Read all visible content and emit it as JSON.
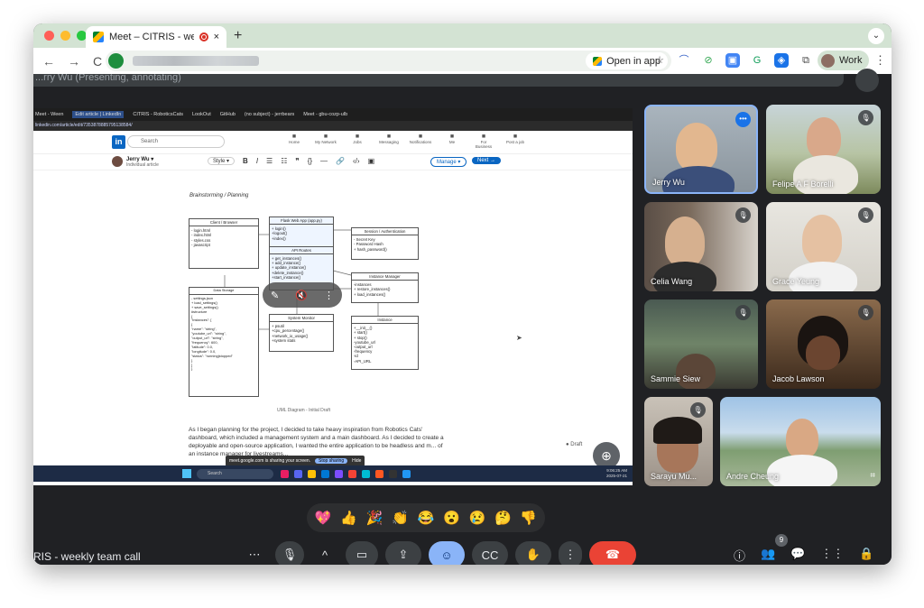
{
  "browser": {
    "tab_title": "Meet – CITRIS - weekly te",
    "tab_close": "×",
    "new_tab": "+",
    "tab_menu": "⌄",
    "open_in_app": "Open in app",
    "profile_name": "Work",
    "nav_back": "←",
    "nav_forward": "→",
    "nav_reload": "C"
  },
  "topbar_text": "...rry Wu (Presenting, annotating)",
  "shared_screen": {
    "browser_tabs": [
      "Meet - Ween",
      "Edit article | LinkedIn",
      "CITRIS - RoboticsCats",
      "LookOut",
      "GitHub",
      "(no subject) - jerrbears",
      "Meet - gbu-cozp-ulb"
    ],
    "address": "linkedin.com/article/edit/7353878885795138584/",
    "search_placeholder": "Search",
    "ln_nav": [
      "Home",
      "My Network",
      "Jobs",
      "Messaging",
      "Notifications",
      "Me",
      "For Business",
      "Post a job"
    ],
    "author_name": "Jerry Wu ▾",
    "author_sub": "Individual article",
    "style_label": "Style ▾",
    "manage_label": "Manage ▾",
    "next_label": "Next →",
    "heading": "Brainstorming / Planning",
    "uml": {
      "client": {
        "title": "Client / Browser",
        "lines": [
          "- login.html",
          "- index.html",
          "- styles.css",
          "- javascript"
        ]
      },
      "flask": {
        "title": "Flask Web App (app.py)",
        "lines": [
          "+ login()",
          "+logout()",
          "+index()"
        ]
      },
      "api": {
        "title": "API Routes",
        "lines": [
          "+ get_instances()",
          "+ add_instance()",
          "+ update_instance()",
          "+delete_instance()",
          "+start_instance()"
        ]
      },
      "session": {
        "title": "Session / Authentication",
        "lines": [
          "- Secret Key",
          "- Password Hash",
          "+ hash_password()"
        ]
      },
      "manager": {
        "title": "Instance Manager",
        "lines": [
          "-instances",
          "+ restore_instances()",
          "+ load_instances()"
        ]
      },
      "storage": {
        "title": "Data Storage",
        "lines": [
          "- settings.json",
          "+ load_settings()",
          "+ save_settings()",
          "",
          "#structure",
          "",
          "{",
          "  \"instances\": [",
          "   {",
          "    \"name\": \"string\",",
          "    \"youtube_url\": \"string\",",
          "    \"output_url\": \"string\",",
          "    \"frequency\": 600,",
          "    \"latitude\": 0.0,",
          "    \"longitude\": 0.0,",
          "    \"status\": \"running|stopped\"",
          "   }",
          "  ]",
          "}"
        ]
      },
      "monitor": {
        "title": "System Monitor",
        "lines": [
          "+ psutil",
          "+cpu_percentage()",
          "+network_io_usage()",
          "+system stats"
        ]
      },
      "instance": {
        "title": "Instance",
        "lines": [
          "+__init__()",
          "+ start()",
          "+ stop()",
          "-youtube_url",
          "-output_url",
          "-frequency",
          "-id",
          "-API_URL"
        ]
      }
    },
    "caption": "UML Diagram - Initial Draft",
    "paragraph": "As I began planning for the project, I decided to take heavy inspiration from Robotics Cats' dashboard, which included a management system and a main dashboard. As I decided to create a deployable and open-source application, I wanted the entire application to be headless and m... of an instance manager for livestreams...",
    "share_notice": "meet.google.com is sharing your screen.",
    "stop_sharing": "Stop sharing",
    "hide": "Hide",
    "draft_label": "Draft",
    "taskbar_search": "Search",
    "tray_time": "9:06:25 AM",
    "tray_date": "2025-07-21",
    "tray_lang": "ENG US"
  },
  "participants": [
    {
      "name": "Jerry Wu",
      "muted": false
    },
    {
      "name": "Felipe A F Borelli",
      "muted": true
    },
    {
      "name": "Celia Wang",
      "muted": true
    },
    {
      "name": "Grace Yeung",
      "muted": true
    },
    {
      "name": "Sammie Siew",
      "muted": true
    },
    {
      "name": "Jacob Lawson",
      "muted": true
    },
    {
      "name": "Sarayu Mu...",
      "muted": true
    },
    {
      "name": "Andre Cheung",
      "muted": false
    }
  ],
  "reactions": [
    "💖",
    "👍",
    "🎉",
    "👏",
    "😂",
    "😮",
    "😢",
    "🤔",
    "👎"
  ],
  "meeting_name": "RIS - weekly team call",
  "people_count": "9",
  "colors": {
    "end_call": "#ea4335",
    "reactions_active": "#8ab4f8",
    "accent": "#1a73e8"
  }
}
